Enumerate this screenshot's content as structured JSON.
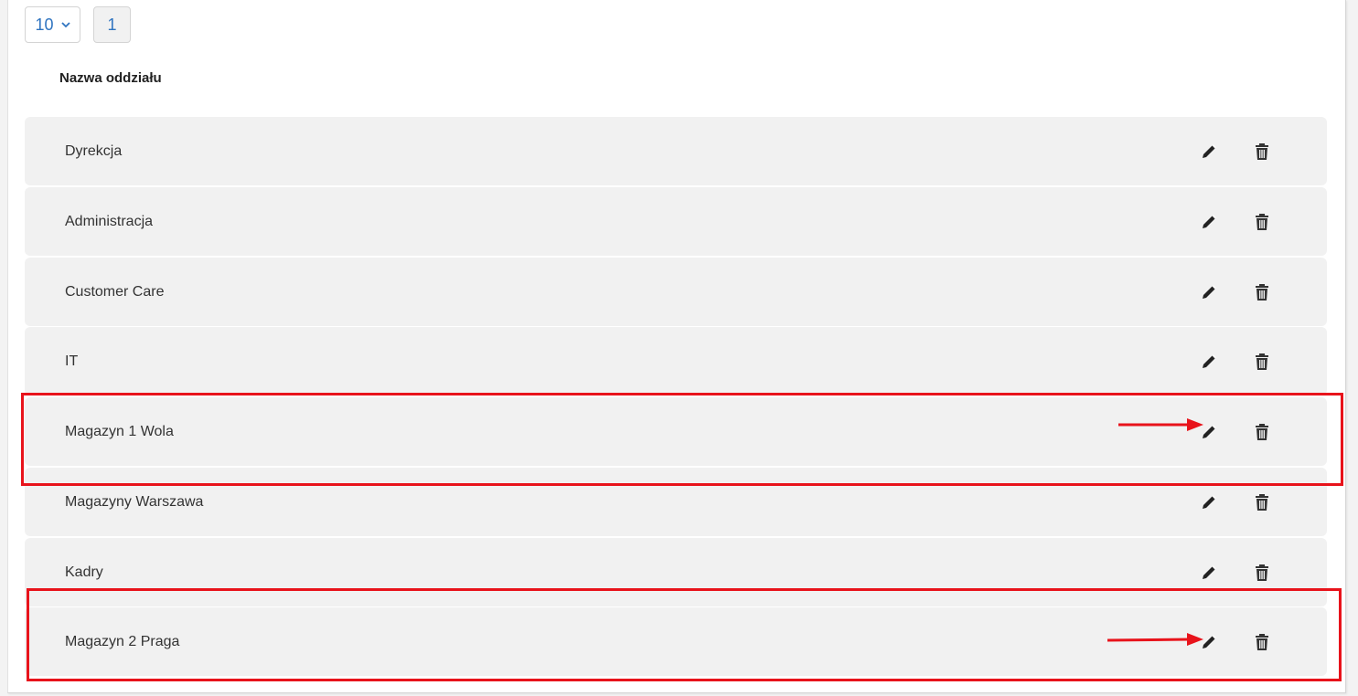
{
  "pagination": {
    "page_size": "10",
    "current_page": "1"
  },
  "table": {
    "column_header": "Nazwa oddziału",
    "rows": [
      {
        "name": "Dyrekcja"
      },
      {
        "name": "Administracja"
      },
      {
        "name": "Customer Care"
      },
      {
        "name": "IT"
      },
      {
        "name": "Magazyn 1 Wola"
      },
      {
        "name": "Magazyny Warszawa"
      },
      {
        "name": "Kadry"
      },
      {
        "name": "Magazyn 2 Praga"
      }
    ]
  },
  "icons": {
    "edit": "pencil-icon",
    "delete": "trash-icon",
    "page_size_dropdown": "chevron-down-icon"
  },
  "colors": {
    "accent": "#2f74c0",
    "annotation": "#e8131b",
    "row_background": "#f1f1f1"
  }
}
